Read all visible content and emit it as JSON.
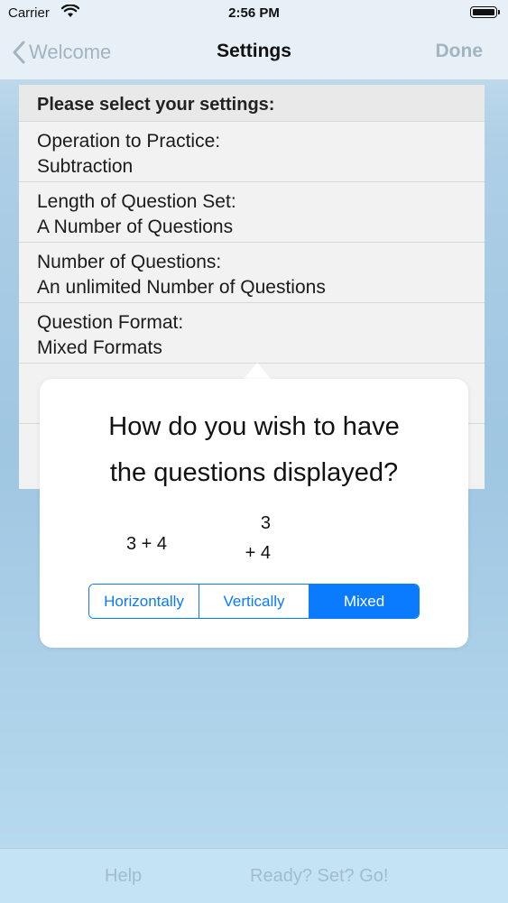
{
  "status_bar": {
    "carrier": "Carrier",
    "time": "2:56 PM",
    "icons": [
      "wifi-icon",
      "battery-icon"
    ]
  },
  "nav_bar": {
    "back_label": "Welcome",
    "title": "Settings",
    "done_label": "Done",
    "back_icon": "chevron-left-icon"
  },
  "settings": {
    "header": "Please select your settings:",
    "rows": [
      {
        "label": "Operation to Practice:",
        "value": "Subtraction"
      },
      {
        "label": "Length of Question Set:",
        "value": "A Number of Questions"
      },
      {
        "label": "Number of Questions:",
        "value": "An unlimited Number of Questions"
      },
      {
        "label": "Question Format:",
        "value": "Mixed Formats"
      }
    ]
  },
  "popover": {
    "question_line1": "How do you wish to have",
    "question_line2": "the questions displayed?",
    "example_horizontal": "3 + 4",
    "example_vertical_top": "3",
    "example_vertical_bottom": "+ 4",
    "segments": [
      "Horizontally",
      "Vertically",
      "Mixed"
    ],
    "selected_segment": "Mixed"
  },
  "toolbar": {
    "help_label": "Help",
    "go_label": "Ready? Set? Go!"
  },
  "colors": {
    "accent": "#0a7aff",
    "disabled_text": "#a3b3c0"
  }
}
